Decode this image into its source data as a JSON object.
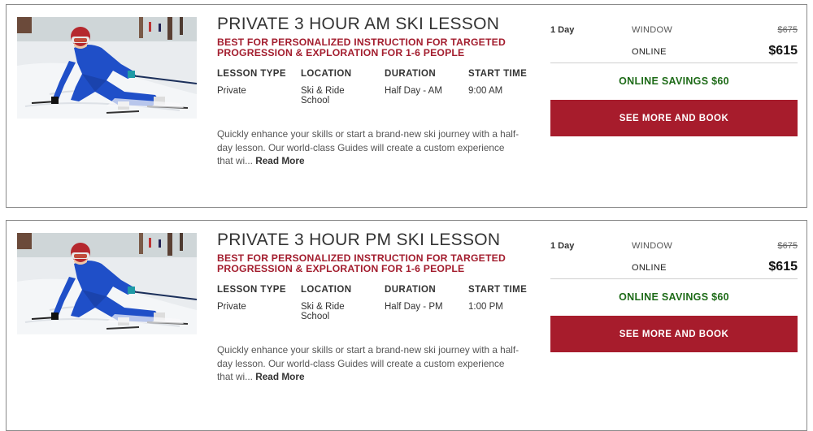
{
  "lessons": [
    {
      "title": "PRIVATE 3 HOUR AM SKI LESSON",
      "subtitle": "BEST FOR PERSONALIZED INSTRUCTION FOR TARGETED PROGRESSION & EXPLORATION FOR 1-6 PEOPLE",
      "specs": [
        {
          "label": "LESSON TYPE",
          "value": "Private"
        },
        {
          "label": "LOCATION",
          "value": "Ski & Ride School"
        },
        {
          "label": "DURATION",
          "value": "Half Day - AM"
        },
        {
          "label": "START TIME",
          "value": "9:00 AM"
        }
      ],
      "description": "Quickly enhance your skills or start a brand-new ski journey with a half-day lesson. Our world-class Guides will create a custom experience that wi...",
      "read_more": "Read More",
      "pricing": {
        "days": "1 Day",
        "window_label": "WINDOW",
        "window_price": "$675",
        "online_label": "ONLINE",
        "online_price": "$615",
        "savings": "ONLINE SAVINGS $60",
        "button": "SEE MORE AND BOOK"
      }
    },
    {
      "title": "PRIVATE 3 HOUR PM SKI LESSON",
      "subtitle": "BEST FOR PERSONALIZED INSTRUCTION FOR TARGETED PROGRESSION & EXPLORATION FOR 1-6 PEOPLE",
      "specs": [
        {
          "label": "LESSON TYPE",
          "value": "Private"
        },
        {
          "label": "LOCATION",
          "value": "Ski & Ride School"
        },
        {
          "label": "DURATION",
          "value": "Half Day - PM"
        },
        {
          "label": "START TIME",
          "value": "1:00 PM"
        }
      ],
      "description": "Quickly enhance your skills or start a brand-new ski journey with a half-day lesson. Our world-class Guides will create a custom experience that wi...",
      "read_more": "Read More",
      "pricing": {
        "days": "1 Day",
        "window_label": "WINDOW",
        "window_price": "$675",
        "online_label": "ONLINE",
        "online_price": "$615",
        "savings": "ONLINE SAVINGS $60",
        "button": "SEE MORE AND BOOK"
      }
    }
  ],
  "colors": {
    "accent_red": "#a71c2c",
    "subtitle_red": "#a31d2e",
    "savings_green": "#1e6b18",
    "skier_suit_blue": "#1f4fc8",
    "helmet_red": "#b5282e"
  }
}
